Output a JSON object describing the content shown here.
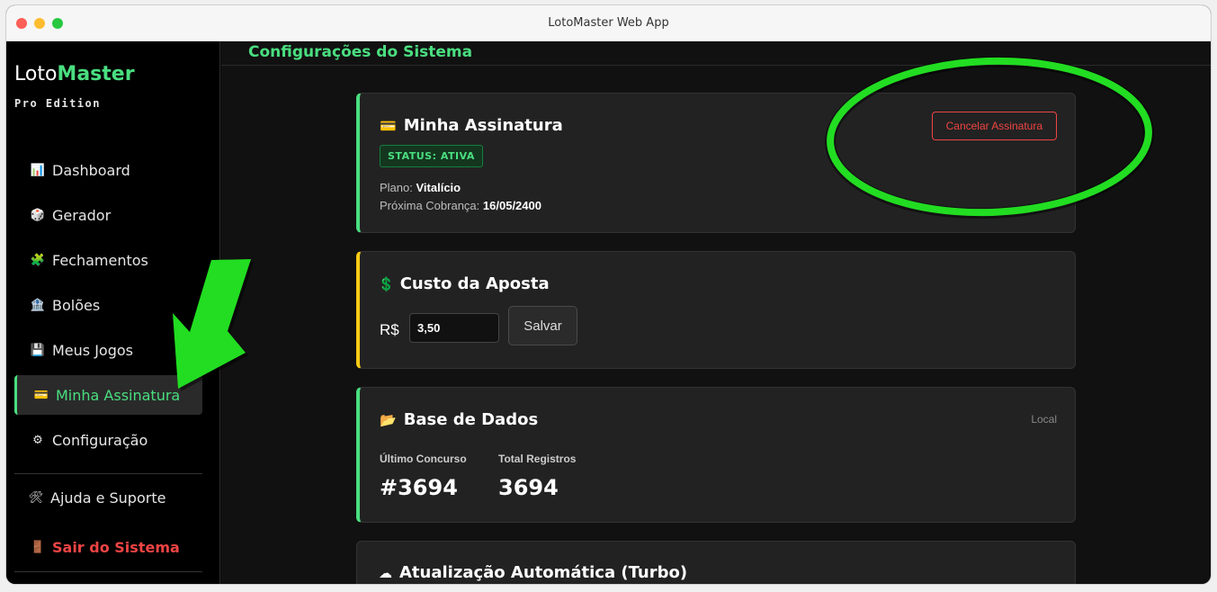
{
  "window": {
    "title": "LotoMaster Web App"
  },
  "brand": {
    "name_light": "Loto",
    "name_bold": "Master",
    "edition": "Pro Edition"
  },
  "sidebar": {
    "items": [
      {
        "icon": "📊",
        "label": "Dashboard"
      },
      {
        "icon": "🎲",
        "label": "Gerador"
      },
      {
        "icon": "🧩",
        "label": "Fechamentos"
      },
      {
        "icon": "🏦",
        "label": "Bolões"
      },
      {
        "icon": "💾",
        "label": "Meus Jogos"
      },
      {
        "icon": "💳",
        "label": "Minha Assinatura"
      },
      {
        "icon": "⚙",
        "label": "Configuração"
      }
    ],
    "help": {
      "icon": "🛠",
      "label": "Ajuda e Suporte"
    },
    "exit": {
      "icon": "🚪",
      "label": "Sair do Sistema"
    }
  },
  "page": {
    "title": "Configurações do Sistema"
  },
  "subscription": {
    "icon": "💳",
    "title": "Minha Assinatura",
    "status": "STATUS: ATIVA",
    "plan_label": "Plano:",
    "plan_value": "Vitalício",
    "next_label": "Próxima Cobrança:",
    "next_value": "16/05/2400",
    "cancel_label": "Cancelar Assinatura"
  },
  "cost": {
    "icon": "💲",
    "title": "Custo da Aposta",
    "currency": "R$",
    "value": "3,50",
    "save_label": "Salvar"
  },
  "database": {
    "icon": "📂",
    "title": "Base de Dados",
    "source": "Local",
    "last_label": "Último Concurso",
    "last_value": "#3694",
    "total_label": "Total Registros",
    "total_value": "3694"
  },
  "update": {
    "icon": "☁",
    "title": "Atualização Automática (Turbo)"
  },
  "colors": {
    "accent": "#4ade80",
    "danger": "#ef4444",
    "warning": "#facc15",
    "annotation": "#22dd22"
  }
}
